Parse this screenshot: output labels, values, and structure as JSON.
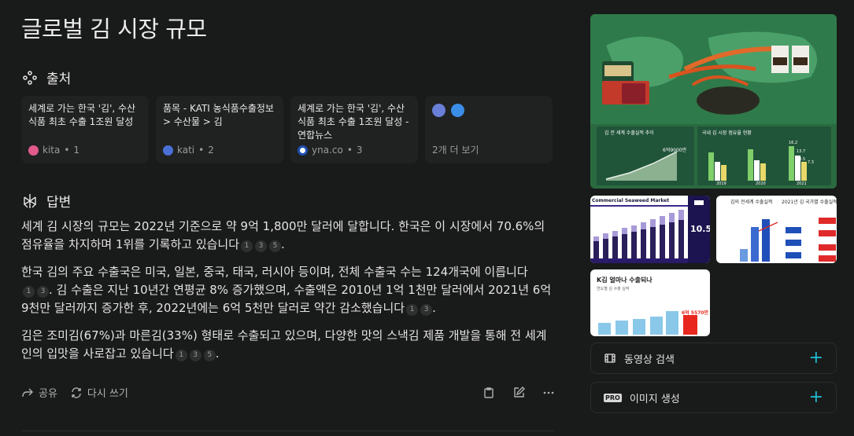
{
  "page": {
    "title": "글로벌 김 시장 규모"
  },
  "sources_section": {
    "label": "출처",
    "cards": [
      {
        "title": "세계로 가는 한국 '김', 수산식품 최초 수출 1조원 달성",
        "site": "kita",
        "index": "1",
        "fav_color": "#e35a8c"
      },
      {
        "title": "품목 - KATI 농식품수출정보 > 수산물 > 김",
        "site": "kati",
        "index": "2",
        "fav_color": "#4a6fd6"
      },
      {
        "title": "세계로 가는 한국 '김', 수산식품 최초 수출 1조원 달성 - 연합뉴스",
        "site": "yna.co",
        "index": "3",
        "fav_color": "#ffffff"
      }
    ],
    "more": {
      "label": "2개 더 보기",
      "icon_colors": [
        "#6a7fd8",
        "#3a8ee8"
      ]
    }
  },
  "answer_section": {
    "label": "답변",
    "paragraphs": [
      {
        "text": "세계 김 시장의 규모는 2022년 기준으로 약 9억 1,800만 달러에 달합니다. 한국은 이 시장에서 70.6%의 점유율을 차지하며 1위를 기록하고 있습니다",
        "cites": [
          "1",
          "3",
          "5"
        ],
        "end": "."
      },
      {
        "text": "한국 김의 주요 수출국은 미국, 일본, 중국, 태국, 러시아 등이며, 전체 수출국 수는 124개국에 이릅니다",
        "cites": [
          "1",
          "3"
        ],
        "end": ". 김 수출은 지난 10년간 연평균 8% 증가했으며, 수출액은 2010년 1억 1천만 달러에서 2021년 6억 9천만 달러까지 증가한 후, 2022년에는 6억 5천만 달러로 약간 감소했습니다",
        "cites2": [
          "1",
          "3"
        ],
        "end2": "."
      },
      {
        "text": "김은 조미김(67%)과 마른김(33%) 형태로 수출되고 있으며, 다양한 맛의 스낵김 제품 개발을 통해 전 세계인의 입맛을 사로잡고 있습니다",
        "cites": [
          "1",
          "3",
          "5"
        ],
        "end": "."
      }
    ]
  },
  "actions": {
    "share": "공유",
    "rewrite": "다시 쓰기"
  },
  "images": {
    "main": {
      "chart_left_title": "김 전 세계 수출실적 추이",
      "chart_left_value": "6억9000만",
      "chart_right_title": "국내 김 시장 점유율 현황",
      "years": [
        "2019",
        "2020",
        "2021"
      ],
      "bar_values": [
        "16.2",
        "13.7",
        "10.5",
        "7.3"
      ]
    },
    "thumb1": {
      "title": "Commercial Seaweed Market",
      "value": "10.5"
    },
    "thumb2": {
      "left_title": "김의 전세계 수출실적",
      "right_title": "2021년 김 국가별 수출실적"
    },
    "thumb3": {
      "title": "K김 얼마나 수출되나",
      "subtitle": "연도별 김 수출 실적",
      "highlight": "6억 5570만"
    }
  },
  "side": {
    "video_search": "동영상 검색",
    "image_gen": "이미지 생성",
    "pro": "PRO"
  },
  "colors": {
    "accent": "#20b8cd",
    "bg": "#191a1a",
    "card": "#202222"
  }
}
